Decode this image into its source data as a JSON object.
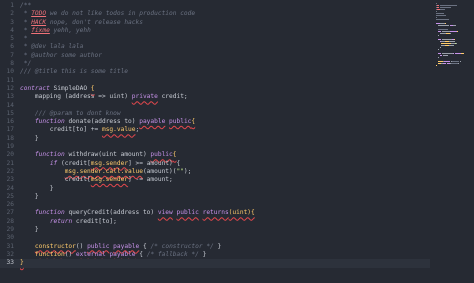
{
  "editor": {
    "lines": [
      {
        "n": "1",
        "tokens": [
          {
            "t": "/**",
            "c": "comment"
          }
        ]
      },
      {
        "n": "2",
        "tokens": [
          {
            "t": " * ",
            "c": "comment"
          },
          {
            "t": "TODO",
            "c": "todo"
          },
          {
            "t": " we do not like todos in production code",
            "c": "comment"
          }
        ]
      },
      {
        "n": "3",
        "tokens": [
          {
            "t": " * ",
            "c": "comment"
          },
          {
            "t": "HACK",
            "c": "todo"
          },
          {
            "t": " nope, don't release hacks",
            "c": "comment"
          }
        ]
      },
      {
        "n": "4",
        "tokens": [
          {
            "t": " * ",
            "c": "comment"
          },
          {
            "t": "fixme",
            "c": "todo"
          },
          {
            "t": " yehh, yehh",
            "c": "comment"
          }
        ]
      },
      {
        "n": "5",
        "tokens": [
          {
            "t": " *",
            "c": "comment"
          }
        ]
      },
      {
        "n": "6",
        "tokens": [
          {
            "t": " * @dev lala lala",
            "c": "comment"
          }
        ]
      },
      {
        "n": "7",
        "tokens": [
          {
            "t": " * @author some author",
            "c": "comment"
          }
        ]
      },
      {
        "n": "8",
        "tokens": [
          {
            "t": " */",
            "c": "comment"
          }
        ]
      },
      {
        "n": "10",
        "tokens": [
          {
            "t": "/// @title this is some title",
            "c": "comment"
          }
        ]
      },
      {
        "n": "11",
        "tokens": []
      },
      {
        "n": "12",
        "tokens": [
          {
            "t": "contract",
            "c": "kw"
          },
          {
            "t": " SimpleDAO ",
            "c": "plain"
          },
          {
            "t": "{",
            "c": "err"
          }
        ]
      },
      {
        "n": "13",
        "tokens": [
          {
            "t": "    mapping (address => uint) ",
            "c": "plain"
          },
          {
            "t": "private",
            "c": "mod"
          },
          {
            "t": " credit;",
            "c": "plain"
          }
        ]
      },
      {
        "n": "14",
        "tokens": []
      },
      {
        "n": "15",
        "tokens": [
          {
            "t": "    /// @param to dont know",
            "c": "comment"
          }
        ]
      },
      {
        "n": "16",
        "tokens": [
          {
            "t": "    ",
            "c": "plain"
          },
          {
            "t": "function",
            "c": "kw"
          },
          {
            "t": " donate(address to) ",
            "c": "plain"
          },
          {
            "t": "payable",
            "c": "mod"
          },
          {
            "t": " ",
            "c": "plain"
          },
          {
            "t": "public",
            "c": "mod"
          },
          {
            "t": "{",
            "c": "err"
          }
        ]
      },
      {
        "n": "17",
        "tokens": [
          {
            "t": "        credit[to] += ",
            "c": "plain"
          },
          {
            "t": "msg.value",
            "c": "err"
          },
          {
            "t": ";",
            "c": "plain"
          }
        ]
      },
      {
        "n": "18",
        "tokens": [
          {
            "t": "    }",
            "c": "plain"
          }
        ]
      },
      {
        "n": "19",
        "tokens": []
      },
      {
        "n": "20",
        "tokens": [
          {
            "t": "    ",
            "c": "plain"
          },
          {
            "t": "function",
            "c": "kw"
          },
          {
            "t": " withdraw(uint amount) ",
            "c": "plain"
          },
          {
            "t": "public",
            "c": "mod"
          },
          {
            "t": "{",
            "c": "err"
          }
        ]
      },
      {
        "n": "21",
        "tokens": [
          {
            "t": "        ",
            "c": "plain"
          },
          {
            "t": "if",
            "c": "kw"
          },
          {
            "t": " (credit[",
            "c": "plain"
          },
          {
            "t": "msg.sender",
            "c": "err"
          },
          {
            "t": "] >= amount) {",
            "c": "plain"
          }
        ]
      },
      {
        "n": "22",
        "tokens": [
          {
            "t": "            ",
            "c": "plain"
          },
          {
            "t": "msg.sender.call.value",
            "c": "err"
          },
          {
            "t": "(amount)(",
            "c": "plain"
          },
          {
            "t": "\"\"",
            "c": "str"
          },
          {
            "t": ");",
            "c": "plain"
          }
        ]
      },
      {
        "n": "23",
        "tokens": [
          {
            "t": "            credit[",
            "c": "plain"
          },
          {
            "t": "msg.sender",
            "c": "err"
          },
          {
            "t": "] -= amount;",
            "c": "plain"
          }
        ]
      },
      {
        "n": "24",
        "tokens": [
          {
            "t": "        }",
            "c": "plain"
          }
        ]
      },
      {
        "n": "25",
        "tokens": [
          {
            "t": "    }",
            "c": "plain"
          }
        ]
      },
      {
        "n": "26",
        "tokens": []
      },
      {
        "n": "27",
        "tokens": [
          {
            "t": "    ",
            "c": "plain"
          },
          {
            "t": "function",
            "c": "kw"
          },
          {
            "t": " queryCredit(address to) ",
            "c": "plain"
          },
          {
            "t": "view",
            "c": "mod"
          },
          {
            "t": " ",
            "c": "plain"
          },
          {
            "t": "public",
            "c": "mod"
          },
          {
            "t": " ",
            "c": "plain"
          },
          {
            "t": "returns",
            "c": "mod"
          },
          {
            "t": "(uint){",
            "c": "err"
          }
        ]
      },
      {
        "n": "28",
        "tokens": [
          {
            "t": "        ",
            "c": "plain"
          },
          {
            "t": "return",
            "c": "kw"
          },
          {
            "t": " credit[to];",
            "c": "plain"
          }
        ]
      },
      {
        "n": "29",
        "tokens": [
          {
            "t": "    }",
            "c": "plain"
          }
        ]
      },
      {
        "n": "30",
        "tokens": []
      },
      {
        "n": "31",
        "tokens": [
          {
            "t": "    ",
            "c": "plain"
          },
          {
            "t": "constructor",
            "c": "err"
          },
          {
            "t": "() ",
            "c": "plain"
          },
          {
            "t": "public",
            "c": "mod"
          },
          {
            "t": " ",
            "c": "plain"
          },
          {
            "t": "payable",
            "c": "mod"
          },
          {
            "t": " { ",
            "c": "plain"
          },
          {
            "t": "/* constructor */",
            "c": "comment"
          },
          {
            "t": " }",
            "c": "plain"
          }
        ]
      },
      {
        "n": "32",
        "tokens": [
          {
            "t": "    ",
            "c": "plain"
          },
          {
            "t": "function",
            "c": "err"
          },
          {
            "t": "() ",
            "c": "plain"
          },
          {
            "t": "external",
            "c": "mod"
          },
          {
            "t": " ",
            "c": "plain"
          },
          {
            "t": "payable",
            "c": "mod"
          },
          {
            "t": " { ",
            "c": "plain"
          },
          {
            "t": "/* fallback */",
            "c": "comment"
          },
          {
            "t": " }",
            "c": "plain"
          }
        ]
      },
      {
        "n": "33",
        "tokens": [
          {
            "t": "}",
            "c": "err"
          }
        ],
        "active": true
      }
    ]
  },
  "colors": {
    "background": "#262a33",
    "comment": "#6b7282",
    "keyword": "#c792ea",
    "error_underline": "#e5484d",
    "todo": "#f07178"
  }
}
